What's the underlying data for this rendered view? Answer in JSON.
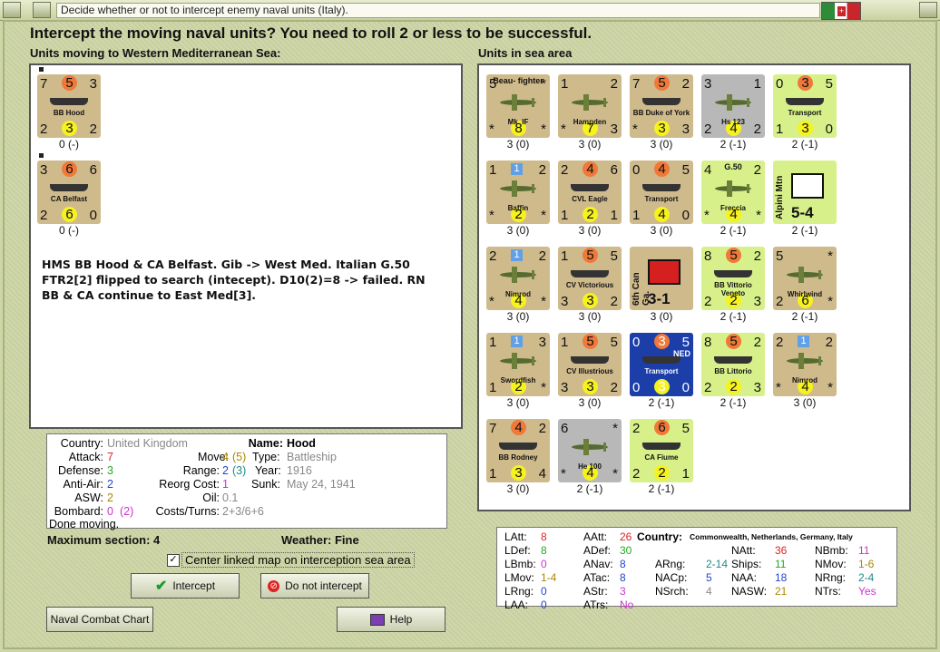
{
  "window": {
    "title": "Decide whether or not to intercept enemy naval units (Italy).",
    "heading": "Intercept the moving naval units?  You need to roll 2 or less to be successful."
  },
  "left_panel": {
    "header": "Units moving to Western Mediterranean Sea:",
    "units": [
      {
        "name": "BB Hood",
        "tl": "7",
        "tc": "5",
        "tr": "3",
        "bl": "2",
        "bc": "3",
        "br": "2",
        "caption": "0 (-)"
      },
      {
        "name": "CA Belfast",
        "tl": "3",
        "tc": "6",
        "tr": "6",
        "bl": "2",
        "bc": "6",
        "br": "0",
        "caption": "0 (-)"
      }
    ],
    "notes": "HMS BB Hood & CA Belfast.  Gib -> West Med.  Italian G.50 FTR2[2] flipped to search (intecept).  D10(2)=8 -> failed.  RN BB & CA continue to East Med[3]."
  },
  "right_panel": {
    "header": "Units in sea area"
  },
  "sea_units": [
    {
      "name": "Mk. IF",
      "top": "Beau- fighter",
      "color": "tan",
      "kind": "plane",
      "tl": "5",
      "tr": "*",
      "bl": "*",
      "bc": "8",
      "br": "*",
      "caption": "3 (0)"
    },
    {
      "name": "Hampden",
      "color": "tan",
      "kind": "plane",
      "tl": "1",
      "tr": "2",
      "bl": "*",
      "bc": "7",
      "br": "3",
      "caption": "3 (0)"
    },
    {
      "name": "BB Duke of York",
      "color": "tan",
      "kind": "ship",
      "tl": "7",
      "tc": "5",
      "tr": "2",
      "bl": "*",
      "bc": "3",
      "br": "3",
      "caption": "3 (0)"
    },
    {
      "name": "Hs 123",
      "color": "grey",
      "kind": "plane",
      "tl": "3",
      "tr": "1",
      "bl": "2",
      "bc": "4",
      "br": "2",
      "caption": "2 (-1)"
    },
    {
      "name": "Transport",
      "color": "lgreen",
      "kind": "ship",
      "tl": "0",
      "tc": "3",
      "tr": "5",
      "bl": "1",
      "bc": "3",
      "br": "0",
      "caption": "2 (-1)"
    },
    {
      "name": "Baffin",
      "color": "tan",
      "kind": "plane",
      "tl": "1",
      "tr": "2",
      "bl": "*",
      "bc": "2",
      "br": "*",
      "sq": "1",
      "caption": "3 (0)"
    },
    {
      "name": "CVL Eagle",
      "color": "tan",
      "kind": "ship",
      "tl": "2",
      "tc": "4",
      "tr": "6",
      "bl": "1",
      "bc": "2",
      "br": "1",
      "caption": "3 (0)"
    },
    {
      "name": "Transport",
      "color": "tan",
      "kind": "ship",
      "tl": "0",
      "tc": "4",
      "tr": "5",
      "bl": "1",
      "bc": "4",
      "br": "0",
      "caption": "3 (0)"
    },
    {
      "name": "Freccia",
      "top": "G.50",
      "color": "lgreen",
      "kind": "plane",
      "tl": "4",
      "tr": "2",
      "bl": "*",
      "bc": "4",
      "br": "*",
      "caption": "2 (-1)"
    },
    {
      "name": "Alpini Mtn",
      "corps": "5-4",
      "color": "lgreen",
      "kind": "army",
      "caption": "2 (-1)"
    },
    {
      "name": "Nimrod",
      "color": "tan",
      "kind": "plane",
      "tl": "2",
      "tr": "2",
      "bl": "*",
      "bc": "4",
      "br": "*",
      "sq": "1",
      "caption": "3 (0)"
    },
    {
      "name": "CV Victorious",
      "color": "tan",
      "kind": "ship",
      "tl": "1",
      "tc": "5",
      "tr": "5",
      "bl": "3",
      "bc": "3",
      "br": "2",
      "caption": "3 (0)"
    },
    {
      "name": "6th Can Ga.",
      "corps": "3-1",
      "color": "tan",
      "kind": "army-can",
      "caption": "3 (0)"
    },
    {
      "name": "BB Vittorio Veneto",
      "color": "lgreen",
      "kind": "ship",
      "tl": "8",
      "tc": "5",
      "tr": "2",
      "bl": "2",
      "bc": "2",
      "br": "3",
      "caption": "2 (-1)"
    },
    {
      "name": "Whirlwind",
      "color": "tan",
      "kind": "plane",
      "tl": "5",
      "tr": "*",
      "bl": "2",
      "bc": "6",
      "br": "*",
      "caption": "2 (-1)"
    },
    {
      "name": "Swordfish",
      "color": "tan",
      "kind": "plane",
      "tl": "1",
      "tr": "3",
      "bl": "1",
      "bc": "2",
      "br": "*",
      "sq": "1",
      "caption": "3 (0)"
    },
    {
      "name": "CV Illustrious",
      "color": "tan",
      "kind": "ship",
      "tl": "1",
      "tc": "5",
      "tr": "5",
      "bl": "3",
      "bc": "3",
      "br": "2",
      "caption": "3 (0)"
    },
    {
      "name": "Transport",
      "nation": "NED",
      "color": "blue",
      "kind": "ship",
      "tl": "0",
      "tc": "3",
      "tr": "5",
      "bl": "0",
      "bc": "3",
      "br": "0",
      "caption": "2 (-1)"
    },
    {
      "name": "BB Littorio",
      "color": "lgreen",
      "kind": "ship",
      "tl": "8",
      "tc": "5",
      "tr": "2",
      "bl": "2",
      "bc": "2",
      "br": "3",
      "caption": "2 (-1)"
    },
    {
      "name": "Nimrod",
      "color": "tan",
      "kind": "plane",
      "tl": "2",
      "tr": "2",
      "bl": "*",
      "bc": "4",
      "br": "*",
      "sq": "1",
      "caption": "3 (0)"
    },
    {
      "name": "BB Rodney",
      "color": "tan",
      "kind": "ship",
      "tl": "7",
      "tc": "4",
      "tr": "2",
      "bl": "1",
      "bc": "3",
      "br": "4",
      "caption": "3 (0)"
    },
    {
      "name": "He 100",
      "color": "grey",
      "kind": "plane",
      "tl": "6",
      "tr": "*",
      "bl": "*",
      "bc": "4",
      "br": "*",
      "caption": "2 (-1)"
    },
    {
      "name": "CA Fiume",
      "color": "lgreen",
      "kind": "ship",
      "tl": "2",
      "tc": "6",
      "tr": "5",
      "bl": "2",
      "bc": "2",
      "br": "1",
      "caption": "2 (-1)"
    }
  ],
  "details": {
    "country_label": "Country:",
    "country": "United Kingdom",
    "attack_label": "Attack:",
    "attack": "7",
    "defense_label": "Defense:",
    "defense": "3",
    "antiair_label": "Anti-Air:",
    "antiair": "2",
    "asw_label": "ASW:",
    "asw": "2",
    "bombard_label": "Bombard:",
    "bombard": "0",
    "bombard2": "(2)",
    "status": "Done moving.",
    "name_label": "Name:",
    "name": "Hood",
    "move_label": "Move:",
    "move": "4",
    "move2": "(5)",
    "type_label": "Type:",
    "type": "Battleship",
    "range_label": "Range:",
    "range": "2",
    "range2": "(3)",
    "year_label": "Year:",
    "year": "1916",
    "reorg_label": "Reorg Cost:",
    "reorg": "1",
    "sunk_label": "Sunk:",
    "sunk": "May 24, 1941",
    "oil_label": "Oil:",
    "oil": "0.1",
    "costs_label": "Costs/Turns:",
    "costs": "2+3/6+6"
  },
  "footer": {
    "max_section": "Maximum section: 4",
    "weather": "Weather:  Fine",
    "center_checkbox": "Center linked map on interception sea area",
    "center_checked": true,
    "intercept_label": "Intercept",
    "no_intercept_label": "Do not intercept",
    "naval_chart_label": "Naval Combat Chart",
    "help_label": "Help"
  },
  "stats": {
    "country_label": "Country:",
    "country": "Commonwealth, Netherlands, Germany, Italy",
    "rows": [
      {
        "k": "LAtt:",
        "v": "8",
        "c": "#d22"
      },
      {
        "k": "LDef:",
        "v": "8",
        "c": "#2a2"
      },
      {
        "k": "LBmb:",
        "v": "0",
        "c": "#c3c"
      },
      {
        "k": "LMov:",
        "v": "1-4",
        "c": "#a80"
      },
      {
        "k": "LRng:",
        "v": "0",
        "c": "#24c"
      },
      {
        "k": "LAA:",
        "v": "0",
        "c": "#24c"
      },
      {
        "k": "AAtt:",
        "v": "26",
        "c": "#d22"
      },
      {
        "k": "ADef:",
        "v": "30",
        "c": "#2a2"
      },
      {
        "k": "ANav:",
        "v": "8",
        "c": "#24c"
      },
      {
        "k": "ATac:",
        "v": "8",
        "c": "#24c"
      },
      {
        "k": "AStr:",
        "v": "3",
        "c": "#c3c"
      },
      {
        "k": "ATrs:",
        "v": "No",
        "c": "#c3c"
      },
      {
        "k": "ARng:",
        "v": "2-14",
        "c": "#288"
      },
      {
        "k": "NACp:",
        "v": "5",
        "c": "#24c"
      },
      {
        "k": "NSrch:",
        "v": "4",
        "c": "#888"
      },
      {
        "k": "NAtt:",
        "v": "36",
        "c": "#d22"
      },
      {
        "k": "Ships:",
        "v": "11",
        "c": "#2a2"
      },
      {
        "k": "NAA:",
        "v": "18",
        "c": "#24c"
      },
      {
        "k": "NASW:",
        "v": "21",
        "c": "#a80"
      },
      {
        "k": "NBmb:",
        "v": "11",
        "c": "#c3c"
      },
      {
        "k": "NMov:",
        "v": "1-6",
        "c": "#a80"
      },
      {
        "k": "NRng:",
        "v": "2-4",
        "c": "#288"
      },
      {
        "k": "NTrs:",
        "v": "Yes",
        "c": "#c3c"
      }
    ]
  }
}
